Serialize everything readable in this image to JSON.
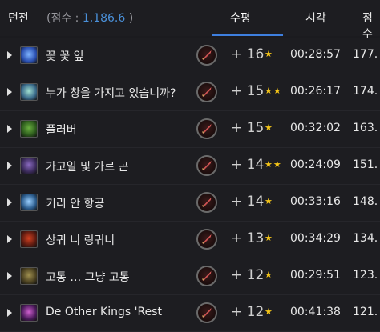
{
  "header": {
    "dungeon_label": "던전",
    "score_prefix": "(점수 : ",
    "score_value": "1,186.6",
    "score_suffix": " )",
    "level_label": "수평",
    "time_label": "시각",
    "score_label": "점수"
  },
  "rows": [
    {
      "name": "꽃 꽃 잎",
      "level": "+ 16",
      "stars": "★",
      "time": "00:28:57",
      "score": "177.",
      "icon_color": "#2a4fb0",
      "icon_accent": "#7fb4ff"
    },
    {
      "name": "누가 창을 가지고 있습니까?",
      "level": "+ 15",
      "stars": "★★",
      "time": "00:26:17",
      "score": "174.",
      "icon_color": "#3a6a8a",
      "icon_accent": "#a0e0d0"
    },
    {
      "name": "플러버",
      "level": "+ 15",
      "stars": "★",
      "time": "00:32:02",
      "score": "163.",
      "icon_color": "#2c5a1c",
      "icon_accent": "#6ab040"
    },
    {
      "name": "가고일 및 가르 곤",
      "level": "+ 14",
      "stars": "★★",
      "time": "00:24:09",
      "score": "151.",
      "icon_color": "#3a2a5a",
      "icon_accent": "#8a6ac0"
    },
    {
      "name": "키리 안 항공",
      "level": "+ 14",
      "stars": "★",
      "time": "00:33:16",
      "score": "148.",
      "icon_color": "#2a5a8a",
      "icon_accent": "#9ad0ff"
    },
    {
      "name": "상귀 니 링귀니",
      "level": "+ 13",
      "stars": "★",
      "time": "00:34:29",
      "score": "134.",
      "icon_color": "#5a1a10",
      "icon_accent": "#d04020"
    },
    {
      "name": "고통 … 그냥 고통",
      "level": "+ 12",
      "stars": "★",
      "time": "00:29:51",
      "score": "123.",
      "icon_color": "#4a4020",
      "icon_accent": "#a09050"
    },
    {
      "name": "De Other Kings 'Rest",
      "level": "+ 12",
      "stars": "★",
      "time": "00:41:38",
      "score": "121.",
      "icon_color": "#4a1a5a",
      "icon_accent": "#d060d0"
    }
  ],
  "icons": {
    "expand": "caret-right-icon",
    "affix": "sword-affix-icon",
    "star": "star-icon"
  }
}
